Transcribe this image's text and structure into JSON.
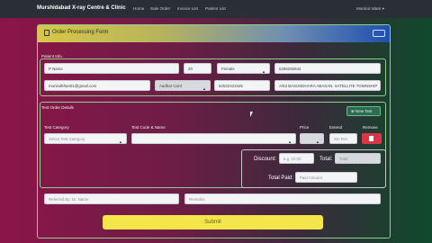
{
  "navbar": {
    "brand": "Murshidabad X-ray Centre & Clinic",
    "links": [
      "Home",
      "Sale Order",
      "Invoice List",
      "Patient List"
    ],
    "user": "Monirul Islam ▾"
  },
  "card": {
    "title": "Order Processing Form"
  },
  "patient": {
    "section_label": "Patient Info.",
    "name": "P Name",
    "age": "20",
    "gender": "Female",
    "phone": "6296292644",
    "email": "monirulkhan01@gmail.com",
    "id_type": "Aadhar Card",
    "id_number": "52022423425",
    "address": "A/63 BASUNDHARA ABASAN, SATELLITE TOWNSHIP"
  },
  "tests": {
    "section_label": "Test Order Details",
    "new_test_label": "New Test",
    "columns": {
      "category": "Test Category",
      "code_name": "Test Code & Name",
      "price": "Price",
      "extend": "Extend",
      "remove": "Remove"
    },
    "row": {
      "category_placeholder": "Select Test Category",
      "code_name_value": "",
      "price_value": "",
      "extend_placeholder": "Xtn Rcv"
    }
  },
  "totals": {
    "discount_label": "Discount:",
    "discount_placeholder": "e.g. 22.00",
    "total_label": "Total:",
    "total_placeholder": "Total",
    "total_paid_label": "Total Paid:",
    "total_paid_placeholder": "Paid Amount"
  },
  "extra": {
    "referred_placeholder": "Referred By: Dr. Name",
    "remarks_placeholder": "Remarks"
  },
  "submit_label": "Submit",
  "colors": {
    "navbar": "#2a2f36",
    "submit": "#f3e54a",
    "remove": "#dc3545",
    "border": "#8fd08f"
  }
}
